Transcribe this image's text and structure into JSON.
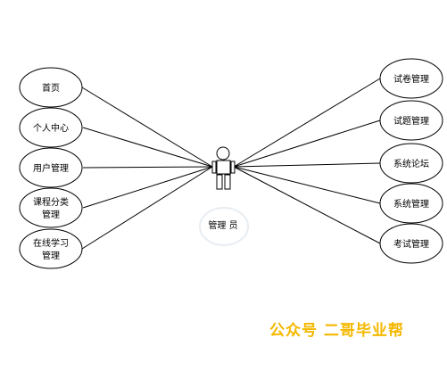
{
  "diagram": {
    "actor": {
      "label": "管理 员"
    },
    "left_usecases": [
      {
        "lines": [
          "首页"
        ]
      },
      {
        "lines": [
          "个人中心"
        ]
      },
      {
        "lines": [
          "用户管理"
        ]
      },
      {
        "lines": [
          "课程分类",
          "管理"
        ]
      },
      {
        "lines": [
          "在线学习",
          "管理"
        ]
      }
    ],
    "right_usecases": [
      {
        "lines": [
          "试卷管理"
        ]
      },
      {
        "lines": [
          "试题管理"
        ]
      },
      {
        "lines": [
          "系统论坛"
        ]
      },
      {
        "lines": [
          "系统管理"
        ]
      },
      {
        "lines": [
          "考试管理"
        ]
      }
    ]
  },
  "watermark": {
    "text": "公众号 二哥毕业帮",
    "color": "#f5b800"
  }
}
